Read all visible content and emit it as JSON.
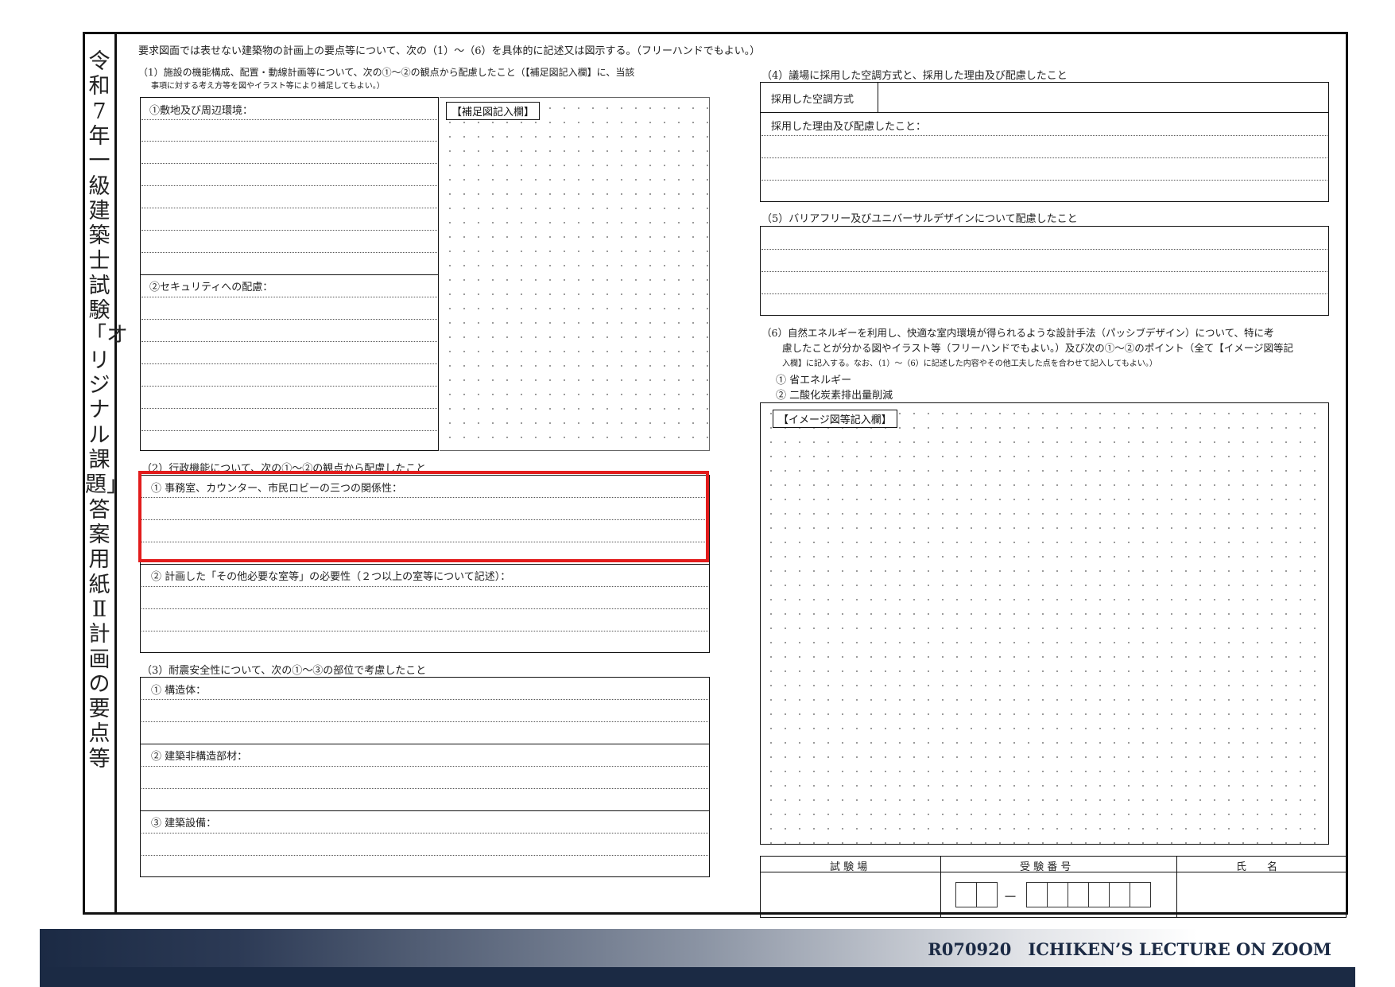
{
  "vertical_title": "令和7年一級建築士試験「オリジナル課題」答案用紙Ⅱ計画の要点等",
  "intro": "要求図面では表せない建築物の計画上の要点等について、次の（1）～（6）を具体的に記述又は図示する。（フリーハンドでもよい。）",
  "s1": {
    "heading_line1": "（1）施設の機能構成、配置・動線計画等について、次の①～②の観点から配慮したこと（【補足図記入欄】に、当該",
    "heading_line2": "事項に対する考え方等を図やイラスト等により補足してもよい。）",
    "item1": "①敷地及び周辺環境：",
    "item2": "②セキュリティへの配慮：",
    "supp_label": "【補足図記入欄】"
  },
  "s2": {
    "heading": "（2）行政機能について、次の①～②の観点から配慮したこと",
    "item1": "① 事務室、カウンター、市民ロビーの三つの関係性：",
    "item2": "② 計画した「その他必要な室等」の必要性（２つ以上の室等について記述）："
  },
  "s3": {
    "heading": "（3）耐震安全性について、次の①～③の部位で考慮したこと",
    "item1": "① 構造体：",
    "item2": "② 建築非構造部材：",
    "item3": "③ 建築設備："
  },
  "s4": {
    "heading": "（4）議場に採用した空調方式と、採用した理由及び配慮したこと",
    "label1": "採用した空調方式",
    "label2": "採用した理由及び配慮したこと："
  },
  "s5": {
    "heading": "（5）バリアフリー及びユニバーサルデザインについて配慮したこと"
  },
  "s6": {
    "line1": "（6）自然エネルギーを利用し、快適な室内環境が得られるような設計手法（パッシブデザイン）について、特に考",
    "line2": "慮したことが分かる図やイラスト等（フリーハンドでもよい。）及び次の①～②のポイント（全て【イメージ図等記",
    "line3": "入欄】に記入する。なお、（1）～（6）に記述した内容やその他工夫した点を合わせて記入してもよい。）",
    "point1": "① 省エネルギー",
    "point2": "② 二酸化炭素排出量削減",
    "image_label": "【イメージ図等記入欄】"
  },
  "exam_table": {
    "col1": "試 験 場",
    "col2": "受 験 番 号",
    "col3": "氏　　名",
    "dash": "－"
  },
  "footer": "R070920　ICHIKEN’S LECTURE ON ZOOM",
  "colors": {
    "highlight": "#e21c1c",
    "footer_band": "#1b2a44"
  }
}
